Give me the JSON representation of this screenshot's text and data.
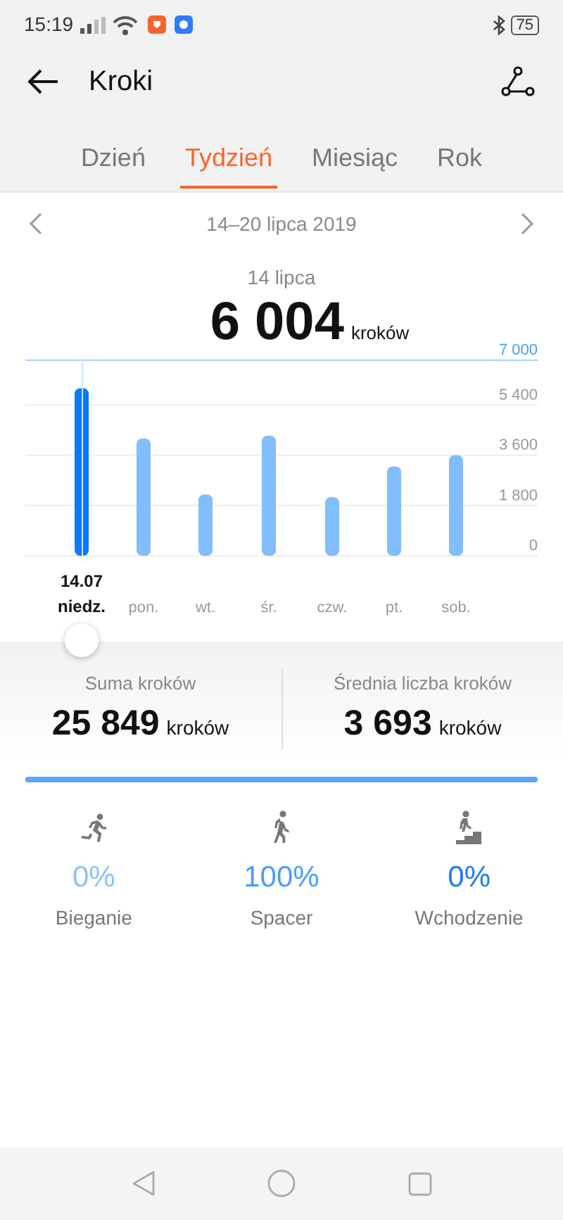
{
  "status_bar": {
    "time": "15:19",
    "battery": "75"
  },
  "header": {
    "title": "Kroki"
  },
  "tabs": [
    {
      "label": "Dzień",
      "selected": false
    },
    {
      "label": "Tydzień",
      "selected": true
    },
    {
      "label": "Miesiąc",
      "selected": false
    },
    {
      "label": "Rok",
      "selected": false
    }
  ],
  "range": {
    "label": "14–20 lipca 2019"
  },
  "selected_day": {
    "date": "14 lipca",
    "value": "6 004",
    "unit": "kroków"
  },
  "chart_data": {
    "type": "bar",
    "categories": [
      "niedz.",
      "pon.",
      "wt.",
      "śr.",
      "czw.",
      "pt.",
      "sob."
    ],
    "series": [
      {
        "color": "#0a7aff",
        "values": [
          6000,
          null,
          null,
          null,
          null,
          null,
          null
        ]
      },
      {
        "color": "#82bdfd",
        "values": [
          null,
          4200,
          2200,
          4300,
          2100,
          3200,
          3600
        ]
      }
    ],
    "grid": true,
    "ylim": [
      0,
      7000
    ],
    "yticks": [
      {
        "value": 0,
        "label": "0"
      },
      {
        "value": 1800,
        "label": "1 800"
      },
      {
        "value": 3600,
        "label": "3 600"
      },
      {
        "value": 5400,
        "label": "5 400"
      },
      {
        "value": 7000,
        "label": "7 000"
      }
    ]
  },
  "days": [
    {
      "selected": true,
      "date": "14.07"
    },
    {
      "selected": false
    },
    {
      "selected": false
    },
    {
      "selected": false
    },
    {
      "selected": false
    },
    {
      "selected": false
    },
    {
      "selected": false
    }
  ],
  "summary": [
    {
      "label": "Suma kroków",
      "value": "25 849",
      "unit": "kroków"
    },
    {
      "label": "Średnia liczba kroków",
      "value": "3 693",
      "unit": "kroków"
    }
  ],
  "activity_bar": {
    "level": 1
  },
  "activities": [
    {
      "kind": "running",
      "percent": "0%",
      "label": "Bieganie",
      "color": "#8cc2fb"
    },
    {
      "kind": "walking",
      "percent": "100%",
      "label": "Spacer",
      "color": "#4a9dfb"
    },
    {
      "kind": "climbing",
      "percent": "0%",
      "label": "Wchodzenie",
      "color": "#1c7cf5"
    }
  ]
}
